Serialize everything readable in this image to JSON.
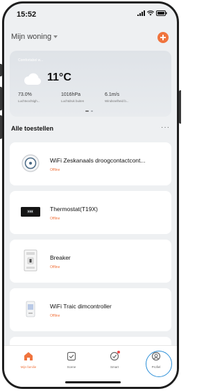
{
  "status_bar": {
    "time": "15:52",
    "icons": [
      "signal-icon",
      "wifi-icon",
      "battery-icon"
    ]
  },
  "header": {
    "home_title": "Mijn woning",
    "add_icon": "plus-icon",
    "accent": "#f0743e"
  },
  "weather": {
    "comfort_label": "Comfortabel w...",
    "icon": "cloud-icon",
    "temperature": "11°C",
    "stats": [
      {
        "value": "73.0%",
        "label": "Luchtvochtigh..."
      },
      {
        "value": "1016hPa",
        "label": "Luchtdruk buiten"
      },
      {
        "value": "6.1m/s",
        "label": "Windsnelheid b..."
      }
    ]
  },
  "devices_section": {
    "title": "Alle toestellen",
    "more": "···"
  },
  "devices": [
    {
      "name": "WiFi Zeskanaals droogcontactcont...",
      "status": "Offline",
      "icon": "dry-contact-relay-icon"
    },
    {
      "name": "Thermostat(T19X)",
      "status": "Offline",
      "icon": "thermostat-icon"
    },
    {
      "name": "Breaker",
      "status": "Offline",
      "icon": "breaker-icon"
    },
    {
      "name": "WiFi Traic dimcontroller",
      "status": "Offline",
      "icon": "dimmer-icon"
    }
  ],
  "tabbar": {
    "tabs": [
      {
        "label": "Mijn familie",
        "icon": "home-icon",
        "active": true
      },
      {
        "label": "Scene",
        "icon": "scene-icon",
        "active": false
      },
      {
        "label": "Smart",
        "icon": "smart-icon",
        "active": false
      },
      {
        "label": "Profiel",
        "icon": "profile-icon",
        "active": false
      }
    ],
    "highlight_color": "#2b8fd8"
  }
}
